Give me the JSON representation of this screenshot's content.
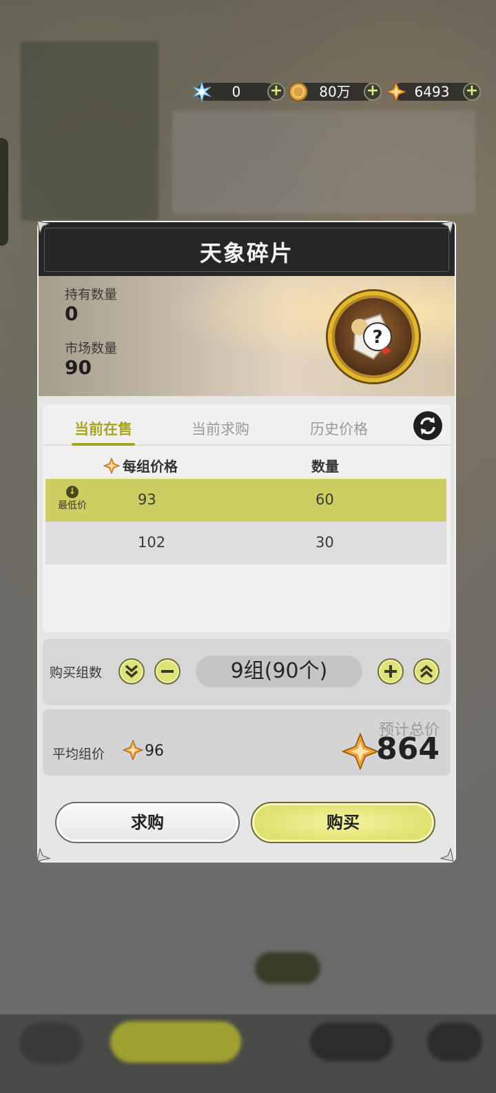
{
  "currencies": [
    {
      "icon": "crystal-icon",
      "value": "0"
    },
    {
      "icon": "coin-icon",
      "value": "80万"
    },
    {
      "icon": "star-shard-icon",
      "value": "6493"
    }
  ],
  "dialog": {
    "title": "天象碎片",
    "held_label": "持有数量",
    "held_value": "0",
    "market_label": "市场数量",
    "market_value": "90"
  },
  "tabs": [
    {
      "label": "当前在售",
      "active": true
    },
    {
      "label": "当前求购",
      "active": false
    },
    {
      "label": "历史价格",
      "active": false
    }
  ],
  "table": {
    "price_header": "每组价格",
    "qty_header": "数量",
    "lowest_tag": "最低价",
    "rows": [
      {
        "price": "93",
        "qty": "60",
        "lowest": true
      },
      {
        "price": "102",
        "qty": "30",
        "lowest": false
      }
    ]
  },
  "purchase": {
    "label": "购买组数",
    "display": "9组(90个)"
  },
  "pricing": {
    "avg_label": "平均组价",
    "avg_value": "96",
    "total_label": "预计总价",
    "total_value": "864"
  },
  "buttons": {
    "request": "求购",
    "buy": "购买"
  },
  "colors": {
    "accent": "#a7a41e",
    "highlight_row": "#ccce62",
    "header_bg": "#262626"
  }
}
